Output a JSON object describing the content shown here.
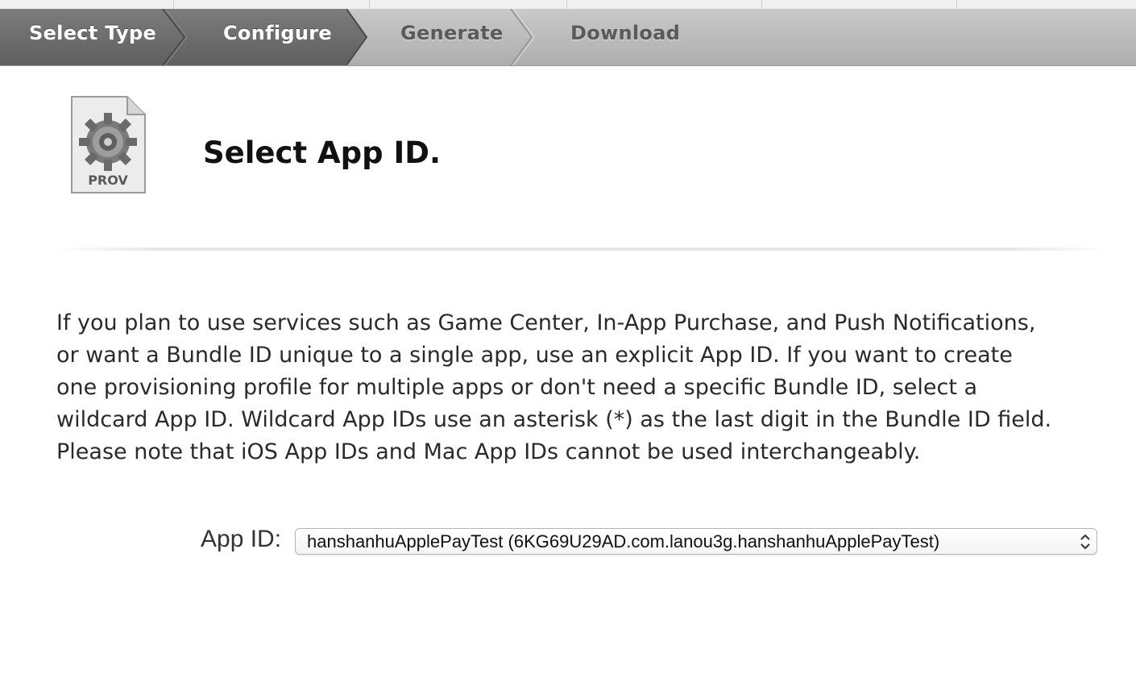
{
  "wizard": {
    "steps": [
      {
        "label": "Select Type",
        "state": "done"
      },
      {
        "label": "Configure",
        "state": "current"
      },
      {
        "label": "Generate",
        "state": "todo"
      },
      {
        "label": "Download",
        "state": "todo"
      }
    ]
  },
  "header": {
    "icon_label": "PROV",
    "icon": "gear-document-icon",
    "title": "Select App ID."
  },
  "description": "If you plan to use services such as Game Center, In-App Purchase, and Push Notifications, or want a Bundle ID unique to a single app, use an explicit App ID. If you want to create one provisioning profile for multiple apps or don't need a specific Bundle ID, select a wildcard App ID. Wildcard App IDs use an asterisk (*) as the last digit in the Bundle ID field. Please note that iOS App IDs and Mac App IDs cannot be used interchangeably.",
  "form": {
    "app_id_label": "App ID:",
    "app_id_value": "hanshanhuApplePayTest (6KG69U29AD.com.lanou3g.hanshanhuApplePayTest)",
    "select_icon": "up-down-chevron-icon"
  },
  "colors": {
    "active_step": "#6f6f6f",
    "inactive_bar": "#bcbcbc",
    "active_text": "#ffffff",
    "inactive_text": "#5a5a5a"
  }
}
